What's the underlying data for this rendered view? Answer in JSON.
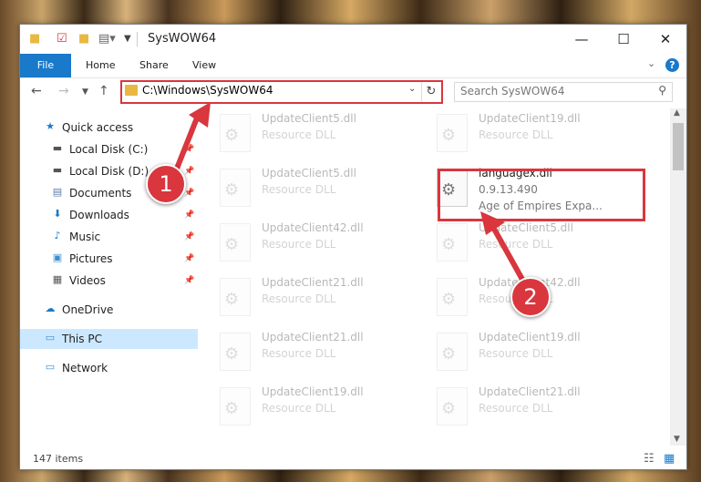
{
  "window": {
    "title": "SysWOW64",
    "controls": {
      "minimize": "—",
      "maximize": "☐",
      "close": "✕"
    }
  },
  "ribbon": {
    "file": "File",
    "home": "Home",
    "share": "Share",
    "view": "View",
    "help": "?"
  },
  "address": {
    "path": "C:\\Windows\\SysWOW64"
  },
  "search": {
    "placeholder": "Search SysWOW64"
  },
  "nav": {
    "quick_access": "Quick access",
    "items": [
      "Local Disk (C:)",
      "Local Disk (D:)",
      "Documents",
      "Downloads",
      "Music",
      "Pictures",
      "Videos"
    ],
    "onedrive": "OneDrive",
    "this_pc": "This PC",
    "network": "Network"
  },
  "files": [
    {
      "name": "UpdateClient5.dll",
      "desc": "Resource DLL"
    },
    {
      "name": "UpdateClient19.dll",
      "desc": "Resource DLL"
    },
    {
      "name": "UpdateClient5.dll",
      "desc": "Resource DLL"
    },
    {
      "name": "languagex.dll",
      "desc": "0.9.13.490",
      "desc2": "Age of Empires Expa..."
    },
    {
      "name": "UpdateClient42.dll",
      "desc": "Resource DLL"
    },
    {
      "name": "UpdateClient5.dll",
      "desc": "Resource DLL"
    },
    {
      "name": "UpdateClient21.dll",
      "desc": "Resource DLL"
    },
    {
      "name": "UpdateClient42.dll",
      "desc": "Resource DLL"
    },
    {
      "name": "UpdateClient21.dll",
      "desc": "Resource DLL"
    },
    {
      "name": "UpdateClient19.dll",
      "desc": "Resource DLL"
    },
    {
      "name": "UpdateClient19.dll",
      "desc": "Resource DLL"
    },
    {
      "name": "UpdateClient21.dll",
      "desc": "Resource DLL"
    }
  ],
  "status": {
    "count": "147 items"
  },
  "callouts": {
    "one": "1",
    "two": "2"
  },
  "colors": {
    "accent": "#1979ca",
    "highlight": "#d9363e",
    "selection": "#cce8ff"
  }
}
